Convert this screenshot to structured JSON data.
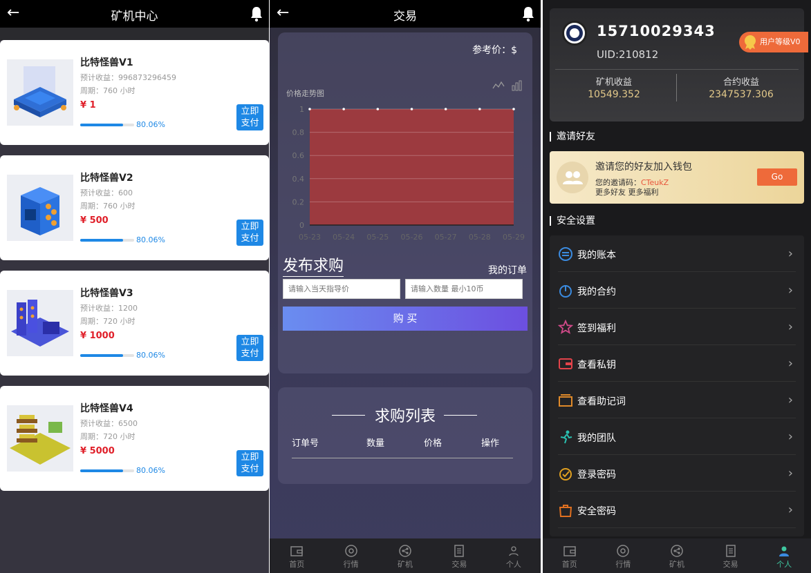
{
  "mining": {
    "title": "矿机中心",
    "machines": [
      {
        "name": "比特怪兽V1",
        "est_label": "预计收益：",
        "est": "996873296459",
        "period": "周期：760 小时",
        "price": "¥ 1",
        "progress_text": "80.06%",
        "progress": 0.8006,
        "btn": [
          "立即",
          "支付"
        ]
      },
      {
        "name": "比特怪兽V2",
        "est_label": "预计收益：",
        "est": "600",
        "period": "周期：760 小时",
        "price": "¥ 500",
        "progress_text": "80.06%",
        "progress": 0.8006,
        "btn": [
          "立即",
          "支付"
        ]
      },
      {
        "name": "比特怪兽V3",
        "est_label": "预计收益：",
        "est": "1200",
        "period": "周期：720 小时",
        "price": "¥ 1000",
        "progress_text": "80.06%",
        "progress": 0.8006,
        "btn": [
          "立即",
          "支付"
        ]
      },
      {
        "name": "比特怪兽V4",
        "est_label": "预计收益：",
        "est": "6500",
        "period": "周期：720 小时",
        "price": "¥ 5000",
        "progress_text": "80.06%",
        "progress": 0.8006,
        "btn": [
          "立即",
          "支付"
        ]
      }
    ]
  },
  "trade": {
    "title": "交易",
    "ref_price": "参考价：$",
    "chart_title": "价格走势图",
    "publish": "发布求购",
    "my_orders": "我的订单",
    "price_placeholder": "请输入当天指导价",
    "qty_placeholder": "请输入数量 最小10币",
    "buy": "购 买",
    "list_title": "求购列表",
    "cols": [
      "订单号",
      "数量",
      "价格",
      "操作"
    ]
  },
  "chart_data": {
    "type": "area",
    "title": "价格走势图",
    "x": [
      "05-23",
      "05-24",
      "05-25",
      "05-26",
      "05-27",
      "05-28",
      "05-29"
    ],
    "values": [
      1,
      1,
      1,
      1,
      1,
      1,
      1
    ],
    "yticks": [
      "0",
      "0.2",
      "0.4",
      "0.6",
      "0.8",
      "1"
    ],
    "ylim": [
      0,
      1
    ],
    "fill_color": "#9c3a3f",
    "grid": true
  },
  "tabbar": {
    "items": [
      {
        "label": "首页",
        "icon": "wallet-icon"
      },
      {
        "label": "行情",
        "icon": "compass-icon"
      },
      {
        "label": "矿机",
        "icon": "share-icon"
      },
      {
        "label": "交易",
        "icon": "document-icon"
      },
      {
        "label": "个人",
        "icon": "person-icon"
      }
    ],
    "active_color": "#3fc7a0"
  },
  "profile": {
    "phone": "15710029343",
    "uid": "UID:210812",
    "level": "用户等级V0",
    "mining_label": "矿机收益",
    "mining_value": "10549.352",
    "contract_label": "合约收益",
    "contract_value": "2347537.306",
    "invite_section": "邀请好友",
    "invite_title": "邀请您的好友加入钱包",
    "invite_code_label": "您的邀请码：",
    "invite_code": "CTeukZ",
    "invite_sub": "更多好友 更多福利",
    "go": "Go",
    "security_section": "安全设置",
    "menu": [
      {
        "label": "我的账本",
        "icon": "ledger-icon"
      },
      {
        "label": "我的合约",
        "icon": "contract-icon"
      },
      {
        "label": "签到福利",
        "icon": "star-icon"
      },
      {
        "label": "查看私钥",
        "icon": "wallet-key-icon"
      },
      {
        "label": "查看助记词",
        "icon": "folder-icon"
      },
      {
        "label": "我的团队",
        "icon": "team-icon"
      },
      {
        "label": "登录密码",
        "icon": "lock-check-icon"
      },
      {
        "label": "安全密码",
        "icon": "bag-icon"
      }
    ]
  }
}
